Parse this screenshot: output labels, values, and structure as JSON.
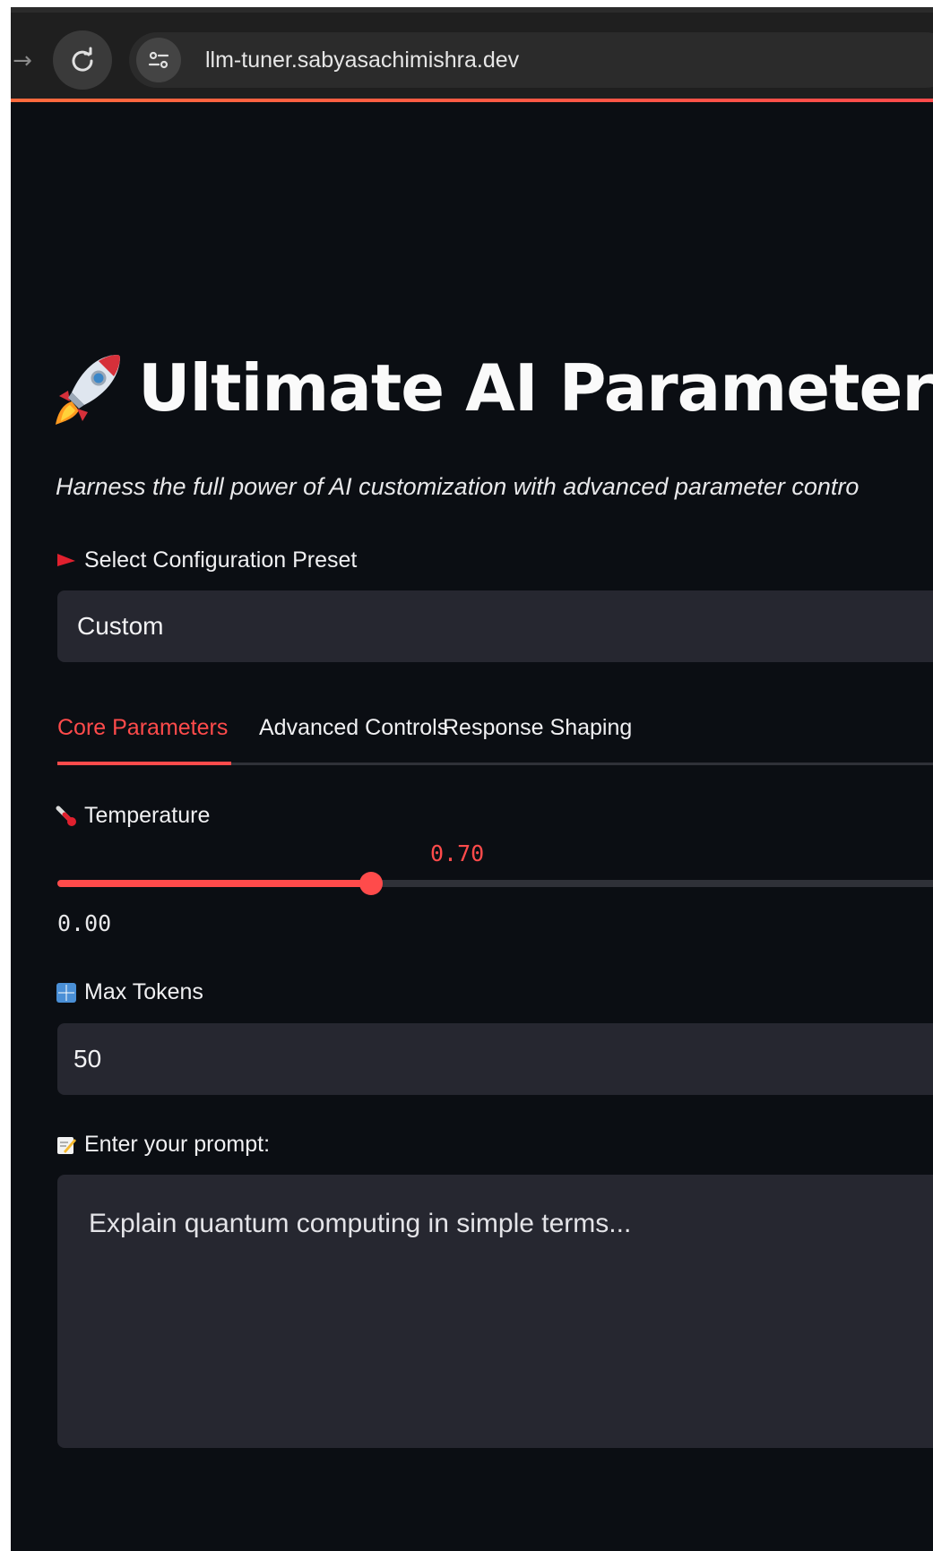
{
  "browser": {
    "url": "llm-tuner.sabyasachimishra.dev",
    "accent_color": "#ff4b4b"
  },
  "app": {
    "title": "Ultimate AI Parameter",
    "title_icon": "rocket-icon",
    "subtitle": "Harness the full power of AI customization with advanced parameter contro",
    "preset": {
      "label": "Select Configuration Preset",
      "label_icon": "red-flag-icon",
      "value": "Custom"
    },
    "tabs": [
      {
        "label": "Core Parameters",
        "active": true
      },
      {
        "label": "Advanced Controls",
        "active": false
      },
      {
        "label": "Response Shaping",
        "active": false
      }
    ],
    "temperature": {
      "label": "Temperature",
      "label_icon": "thermometer-icon",
      "value": "0.70",
      "min_label": "0.00",
      "fraction": 0.35
    },
    "max_tokens": {
      "label": "Max Tokens",
      "label_icon": "numbers-icon",
      "value": "50"
    },
    "prompt": {
      "label": "Enter your prompt:",
      "label_icon": "memo-icon",
      "placeholder": "Explain quantum computing in simple terms..."
    }
  }
}
